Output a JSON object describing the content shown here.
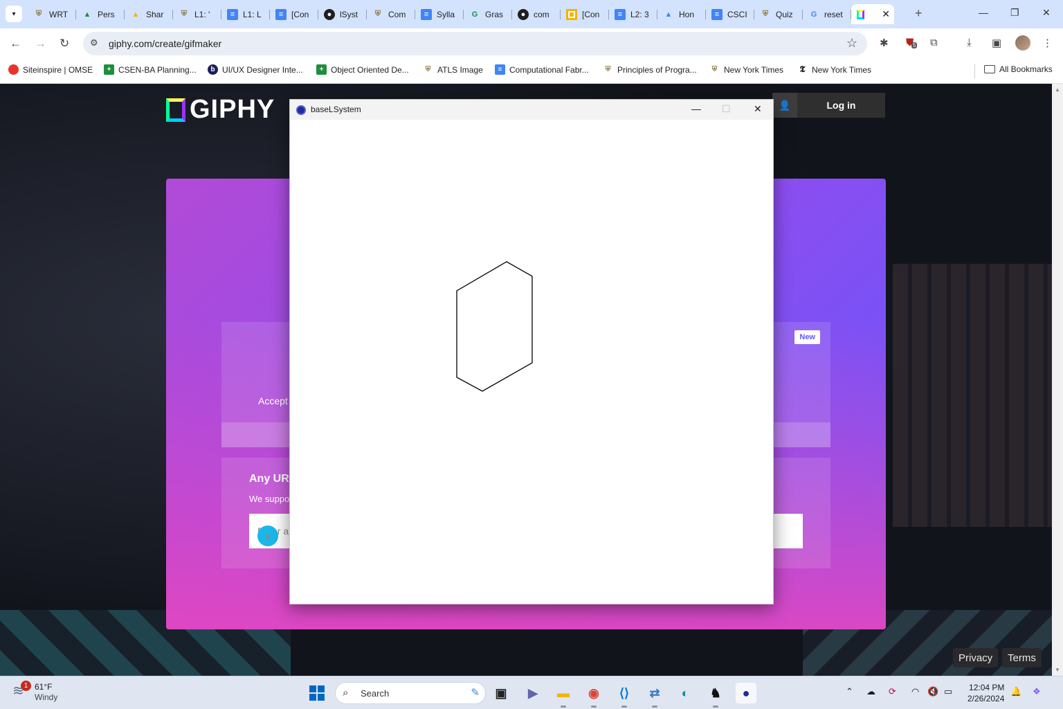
{
  "browser": {
    "tabs": [
      {
        "label": "WRT",
        "icon": "cu-icon"
      },
      {
        "label": "Pers",
        "icon": "drive-icon"
      },
      {
        "label": "Shar",
        "icon": "drive-icon"
      },
      {
        "label": "L1: '",
        "icon": "cu-icon"
      },
      {
        "label": "L1: L",
        "icon": "docs-icon"
      },
      {
        "label": "[Con",
        "icon": "docs-icon"
      },
      {
        "label": "lSyst",
        "icon": "github-icon"
      },
      {
        "label": "Com",
        "icon": "cu-icon"
      },
      {
        "label": "Sylla",
        "icon": "docs-icon"
      },
      {
        "label": "Gras",
        "icon": "grasshopper-icon"
      },
      {
        "label": "com",
        "icon": "github-icon"
      },
      {
        "label": "[Con",
        "icon": "slides-icon"
      },
      {
        "label": "L2: 3",
        "icon": "docs-icon"
      },
      {
        "label": "Hon",
        "icon": "drive-icon"
      },
      {
        "label": "CSCI",
        "icon": "docs-icon"
      },
      {
        "label": "Quiz",
        "icon": "cu-icon"
      },
      {
        "label": "reset",
        "icon": "google-icon"
      },
      {
        "label": "",
        "icon": "giphy-icon",
        "active": true
      }
    ],
    "url": "giphy.com/create/gifmaker",
    "extension_badge": "5",
    "bookmarks": [
      {
        "label": "Siteinspire | OMSE",
        "icon": "red-dot-icon"
      },
      {
        "label": "CSEN-BA Planning...",
        "icon": "sheets-icon"
      },
      {
        "label": "UI/UX Designer Inte...",
        "icon": "b-icon"
      },
      {
        "label": "Object Oriented De...",
        "icon": "sheets-icon"
      },
      {
        "label": "ATLS Image",
        "icon": "cu-icon"
      },
      {
        "label": "Computational Fabr...",
        "icon": "docs-icon"
      },
      {
        "label": "Principles of Progra...",
        "icon": "cu-icon"
      },
      {
        "label": "New York Times",
        "icon": "cu-icon"
      },
      {
        "label": "New York Times",
        "icon": "nyt-icon"
      }
    ],
    "all_bookmarks": "All Bookmarks"
  },
  "giphy": {
    "logo": "GIPHY",
    "login": "Log in",
    "accepts_text": "Accept",
    "new_badge": "New",
    "url_heading": "Any UR",
    "url_sub": "We suppo",
    "url_placeholder": "Enter an",
    "privacy": "Privacy",
    "terms": "Terms"
  },
  "app_window": {
    "title": "baseLSystem"
  },
  "taskbar": {
    "weather_temp": "61°F",
    "weather_desc": "Windy",
    "weather_badge": "1",
    "search": "Search",
    "time": "12:04 PM",
    "date": "2/26/2024"
  },
  "colors": {
    "chrome_tabstrip": "#d3e3fd",
    "giphy_panel_start": "#b24ad7",
    "giphy_panel_end": "#6157ff",
    "windows_accent": "#0067c0"
  }
}
